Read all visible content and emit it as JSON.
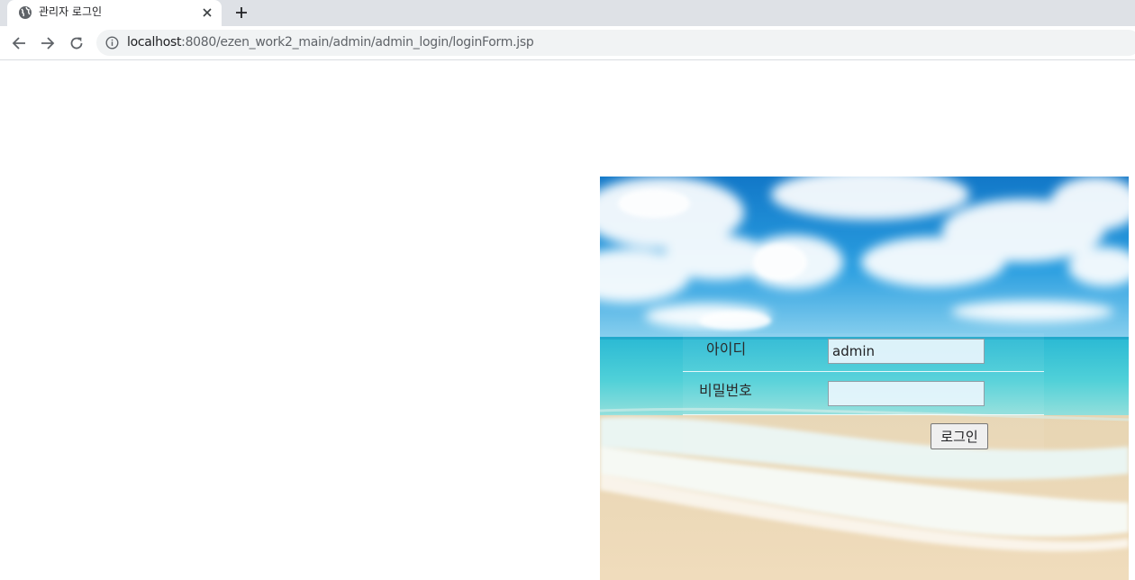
{
  "browser": {
    "tab": {
      "title": "관리자 로그인",
      "favicon": "globe-icon",
      "close_icon": "close-icon"
    },
    "new_tab_icon": "plus-icon",
    "toolbar": {
      "back_icon": "back-arrow-icon",
      "forward_icon": "forward-arrow-icon",
      "reload_icon": "reload-icon",
      "info_icon": "info-icon",
      "url_host": "localhost",
      "url_rest": ":8080/ezen_work2_main/admin/admin_login/loginForm.jsp"
    }
  },
  "login_form": {
    "id_label": "아이디",
    "id_value": "admin",
    "password_label": "비밀번호",
    "password_value": "",
    "submit_label": "로그인"
  },
  "colors": {
    "tabstrip": "#dee1e6",
    "omnibox": "#f1f3f4",
    "sky": "#1a8fd6",
    "sea": "#3ec3d6",
    "sand": "#ecd7b4"
  }
}
